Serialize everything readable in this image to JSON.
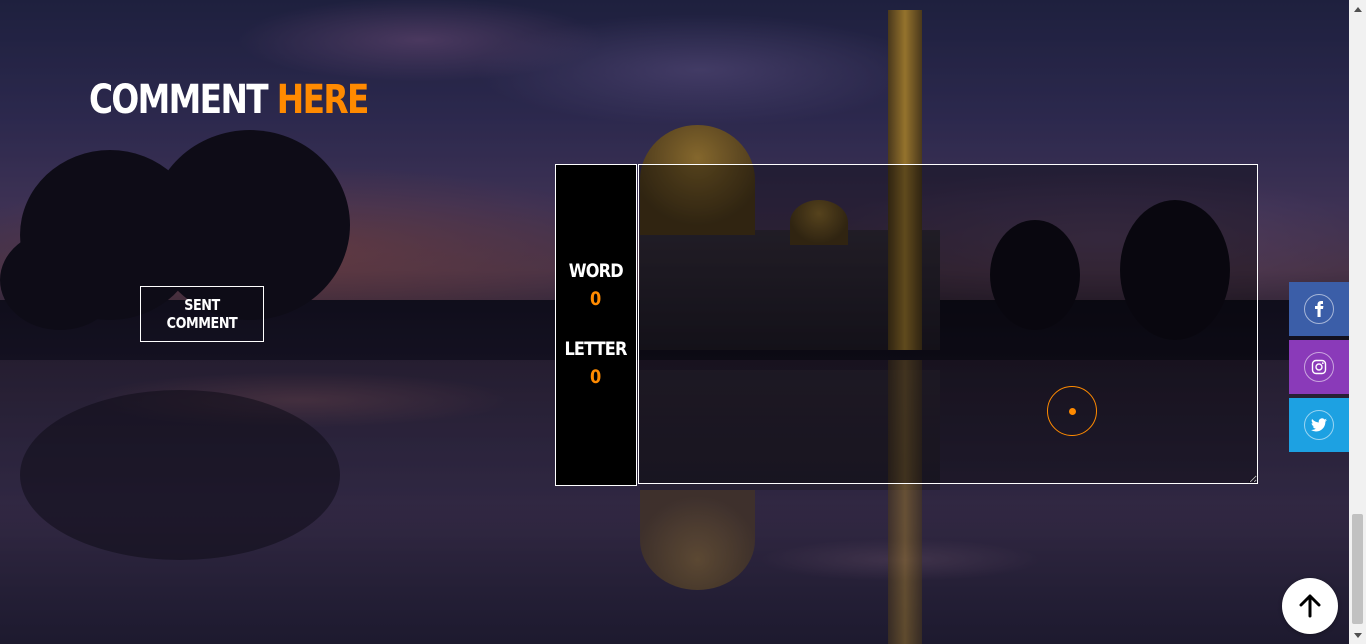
{
  "section": {
    "title_white": "COMMENT",
    "title_orange": "HERE"
  },
  "form": {
    "submit_label": "SENT COMMENT",
    "comment_value": "",
    "counter": {
      "word_label": "WORD",
      "word_count": "0",
      "letter_label": "LETTER",
      "letter_count": "0"
    }
  },
  "social": [
    {
      "name": "facebook",
      "icon": "facebook-icon",
      "color": "#3b5ea8"
    },
    {
      "name": "instagram",
      "icon": "instagram-icon",
      "color": "#8a3ab9"
    },
    {
      "name": "twitter",
      "icon": "twitter-icon",
      "color": "#1da1e2"
    }
  ],
  "colors": {
    "accent": "#ff8a00",
    "text": "#ffffff",
    "panel": "#000000"
  },
  "scroll_to_top_icon": "arrow-up-icon"
}
